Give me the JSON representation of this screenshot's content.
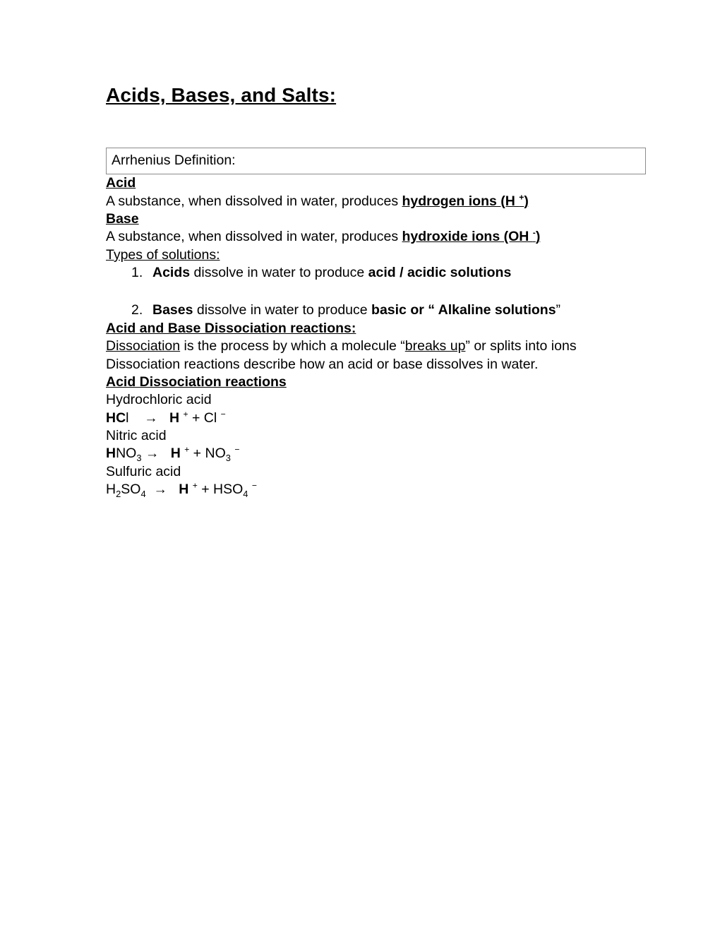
{
  "document": {
    "title": "Acids, Bases, and Salts:",
    "definition_box": {
      "label": "Arrhenius Definition:"
    },
    "acid": {
      "heading": "Acid",
      "definition_lead": "A substance, when dissolved in water, produces ",
      "definition_emphasis": "hydrogen ions (H ",
      "definition_charge": "+",
      "definition_tail": ")"
    },
    "base": {
      "heading": "Base",
      "definition_lead": "A substance, when dissolved in water, produces ",
      "definition_emphasis": "hydroxide ions (OH ",
      "definition_charge": "-",
      "definition_tail": ")"
    },
    "types_of_solutions": {
      "heading": "Types of solutions:",
      "items": [
        {
          "number": "1.",
          "subject": "Acids",
          "middle": " dissolve in water to produce  ",
          "result": "acid / acidic solutions",
          "trailing": ""
        },
        {
          "number": "2.",
          "subject": "Bases",
          "middle": " dissolve in water to produce ",
          "result": "basic or “ Alkaline solutions",
          "trailing": "”"
        }
      ]
    },
    "dissociation_section": {
      "heading": "Acid and Base Dissociation reactions:",
      "definition": {
        "term": "Dissociation",
        "part1": " is the process by which a molecule “",
        "quoted": "breaks up",
        "part2": "” or splits into ions"
      },
      "note": "Dissociation reactions describe how an acid or base dissolves in water."
    },
    "acid_dissociation": {
      "heading": "Acid Dissociation reactions",
      "reactions": [
        {
          "name": "Hydrochloric acid",
          "reactant_bold": "HC",
          "reactant_rest": "l",
          "gap": "    ",
          "arrow": "→",
          "product_bold": "H",
          "product_sup1": "+",
          "product_mid": " + Cl ",
          "product_sup2": "−",
          "product_tail": ""
        },
        {
          "name": "Nitric acid",
          "reactant_bold": "H",
          "reactant_rest": "NO",
          "reactant_sub": "3",
          "gap": " ",
          "arrow": "→",
          "product_bold": "H",
          "product_sup1": "+",
          "product_mid": " + NO",
          "product_sub": "3",
          "product_sup2": "−",
          "product_tail": ""
        },
        {
          "name": "Sulfuric acid",
          "reactant_bold": "",
          "reactant_rest": "H",
          "reactant_sub": "2",
          "reactant_rest2": "SO",
          "reactant_sub2": "4",
          "gap": "  ",
          "arrow": "→",
          "product_bold": "H",
          "product_sup1": "+",
          "product_mid": " + HSO",
          "product_sub": "4",
          "product_sup2": "−",
          "product_tail": ""
        }
      ]
    }
  }
}
